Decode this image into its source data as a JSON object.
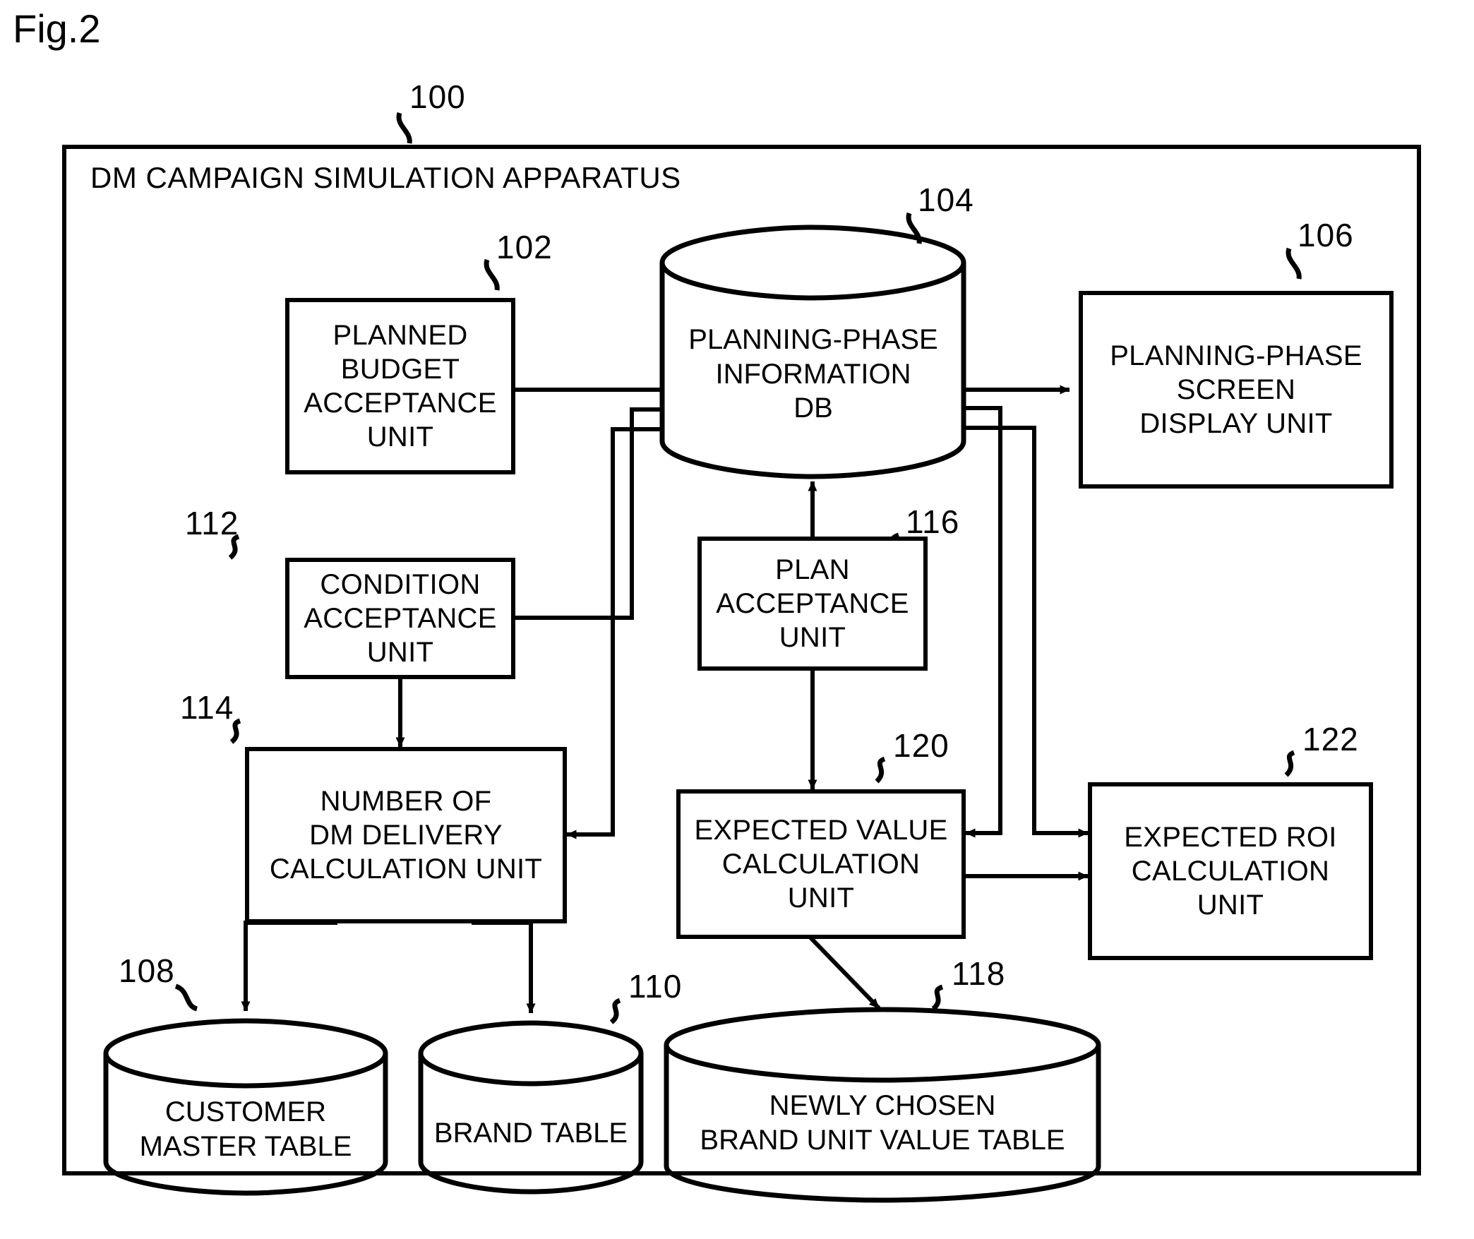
{
  "figure": {
    "label": "Fig.2",
    "apparatus_ref": "100",
    "apparatus_title": "DM CAMPAIGN SIMULATION APPARATUS"
  },
  "blocks": [
    {
      "ref": "102",
      "lines": [
        "PLANNED",
        "BUDGET",
        "ACCEPTANCE",
        "UNIT"
      ],
      "shape": "rect"
    },
    {
      "ref": "104",
      "lines": [
        "PLANNING-PHASE",
        "INFORMATION",
        "DB"
      ],
      "shape": "cylinder"
    },
    {
      "ref": "106",
      "lines": [
        "PLANNING-PHASE",
        "SCREEN",
        "DISPLAY UNIT"
      ],
      "shape": "rect"
    },
    {
      "ref": "108",
      "lines": [
        "CUSTOMER",
        "MASTER TABLE"
      ],
      "shape": "cylinder"
    },
    {
      "ref": "110",
      "lines": [
        "BRAND TABLE"
      ],
      "shape": "cylinder"
    },
    {
      "ref": "112",
      "lines": [
        "CONDITION",
        "ACCEPTANCE",
        "UNIT"
      ],
      "shape": "rect"
    },
    {
      "ref": "114",
      "lines": [
        "NUMBER OF",
        "DM DELIVERY",
        "CALCULATION UNIT"
      ],
      "shape": "rect"
    },
    {
      "ref": "116",
      "lines": [
        "PLAN",
        "ACCEPTANCE",
        "UNIT"
      ],
      "shape": "rect"
    },
    {
      "ref": "118",
      "lines": [
        "NEWLY CHOSEN",
        "BRAND UNIT VALUE TABLE"
      ],
      "shape": "cylinder"
    },
    {
      "ref": "120",
      "lines": [
        "EXPECTED VALUE",
        "CALCULATION",
        "UNIT"
      ],
      "shape": "rect"
    },
    {
      "ref": "122",
      "lines": [
        "EXPECTED ROI",
        "CALCULATION",
        "UNIT"
      ],
      "shape": "rect"
    }
  ],
  "colors": {
    "line": "#000000",
    "background": "#ffffff"
  }
}
